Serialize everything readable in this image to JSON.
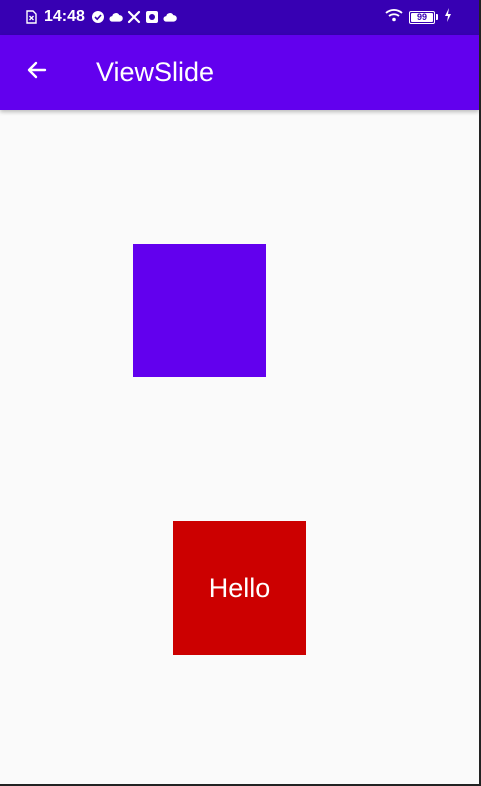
{
  "status_bar": {
    "time": "14:48",
    "battery_level": "99",
    "battery_fraction": 0.99,
    "left_icons": [
      "sim-card-icon",
      "clock-check-icon",
      "cloud-sync-icon",
      "tools-icon",
      "gallery-icon",
      "cloud-icon"
    ],
    "right_icons": [
      "wifi-icon",
      "battery-icon",
      "charging-bolt-icon"
    ],
    "background_color": "#3700b3"
  },
  "app_bar": {
    "title": "ViewSlide",
    "back_icon": "arrow-back-icon",
    "background_color": "#6200ee"
  },
  "content": {
    "purple_box_color": "#6200ee",
    "red_box_color": "#cc0000",
    "red_box_label": "Hello"
  }
}
